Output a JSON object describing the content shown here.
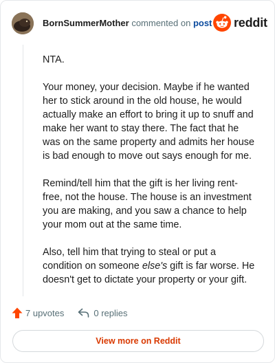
{
  "header": {
    "username": "BornSummerMother",
    "action_text": "commented on",
    "post_link_text": "post",
    "logo_text": "reddit"
  },
  "comment": {
    "paragraphs": [
      {
        "segments": [
          {
            "text": "NTA.",
            "italic": false
          }
        ]
      },
      {
        "segments": [
          {
            "text": "Your money, your decision. Maybe if he wanted her to stick around in the old house, he would actually make an effort to bring it up to snuff and make her want to stay there. The fact that he was on the same property and admits her house is bad enough to move out says enough for me.",
            "italic": false
          }
        ]
      },
      {
        "segments": [
          {
            "text": "Remind/tell him that the gift is her living rent-free, not the house. The house is an investment you are making, and you saw a chance to help your mom out at the same time.",
            "italic": false
          }
        ]
      },
      {
        "segments": [
          {
            "text": "Also, tell him that trying to steal or put a condition on someone ",
            "italic": false
          },
          {
            "text": "else's",
            "italic": true
          },
          {
            "text": " gift is far worse. He doesn't get to dictate your property or your gift.",
            "italic": false
          }
        ]
      }
    ]
  },
  "actions": {
    "upvotes_label": "7 upvotes",
    "replies_label": "0 replies"
  },
  "footer": {
    "view_more_label": "View more on Reddit"
  },
  "colors": {
    "upvote_arrow": "#ff4500",
    "brand_orange": "#ff4500",
    "view_more_text": "#d93900",
    "link_blue": "#0a4a9e",
    "muted_text": "#576f76"
  },
  "icons": {
    "upvote": "upvote-arrow-icon",
    "reply": "reply-arrow-icon",
    "logo": "reddit-snoo-icon"
  }
}
